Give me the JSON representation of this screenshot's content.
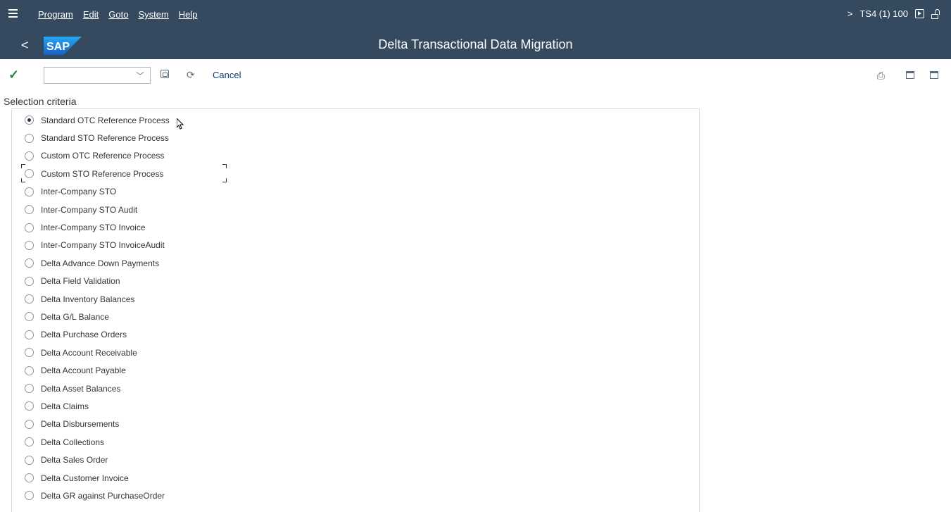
{
  "menubar": {
    "items": [
      "Program",
      "Edit",
      "Goto",
      "System",
      "Help"
    ],
    "system_info": "TS4 (1) 100",
    "chevron": ">"
  },
  "titlebar": {
    "logo_text": "SAP",
    "title": "Delta Transactional Data Migration",
    "back": "<"
  },
  "toolbar": {
    "cancel_label": "Cancel",
    "command_value": ""
  },
  "section_title": "Selection criteria",
  "options": [
    {
      "label": "Standard OTC Reference Process",
      "selected": true
    },
    {
      "label": "Standard STO Reference Process",
      "selected": false
    },
    {
      "label": "Custom OTC Reference Process",
      "selected": false
    },
    {
      "label": "Custom STO Reference Process",
      "selected": false
    },
    {
      "label": "Inter-Company STO",
      "selected": false
    },
    {
      "label": "Inter-Company STO Audit",
      "selected": false
    },
    {
      "label": "Inter-Company STO Invoice",
      "selected": false
    },
    {
      "label": "Inter-Company STO InvoiceAudit",
      "selected": false
    },
    {
      "label": "Delta Advance Down Payments",
      "selected": false
    },
    {
      "label": "Delta Field Validation",
      "selected": false
    },
    {
      "label": "Delta Inventory Balances",
      "selected": false
    },
    {
      "label": "Delta G/L Balance",
      "selected": false
    },
    {
      "label": "Delta Purchase Orders",
      "selected": false
    },
    {
      "label": "Delta Account Receivable",
      "selected": false
    },
    {
      "label": "Delta Account Payable",
      "selected": false
    },
    {
      "label": "Delta Asset Balances",
      "selected": false
    },
    {
      "label": "Delta Claims",
      "selected": false
    },
    {
      "label": "Delta Disbursements",
      "selected": false
    },
    {
      "label": "Delta Collections",
      "selected": false
    },
    {
      "label": "Delta Sales Order",
      "selected": false
    },
    {
      "label": "Delta Customer Invoice",
      "selected": false
    },
    {
      "label": "Delta GR against PurchaseOrder",
      "selected": false
    }
  ],
  "colors": {
    "shell": "#354a5f",
    "sap_logo": "#1a73e8",
    "check": "#1d8a3a",
    "link": "#0a3d73"
  }
}
